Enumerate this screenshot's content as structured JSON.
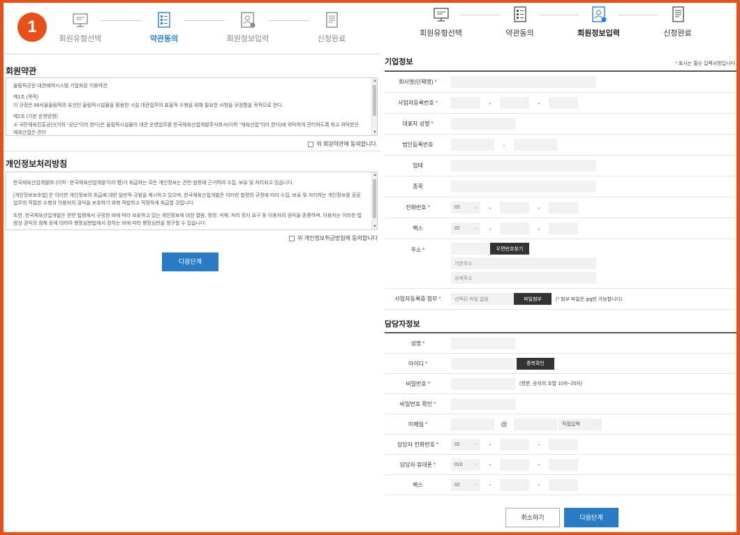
{
  "left": {
    "step_number": "1",
    "steps": [
      "회원유형선택",
      "약관동의",
      "회원정보입력",
      "신청완료"
    ],
    "active_step": 1,
    "terms": {
      "title": "회원약관",
      "lines": [
        "올림픽공원 대관예약시스템 기업회원 이용약관",
        "제1조 (목적)",
        "이 규정은 88서울올림픽의 유산인 올림픽시설물을 활용한 시설 대관업무의 효율적 수행을 위해 필요한 사항을 규정함을 목적으로 한다.",
        "제2조 (기본 운영방향)",
        "① 국민체육진흥공단(이하 \"공단\"이라 한다)은 올림픽시설물의 대관 운영업무를 한국체육산업개발주식회사(이하 \"체육산업\"이라 한다)에 위탁하여 관리하도록 하고 위탁받은 체육산업은 관리"
      ],
      "agree_label": "위 회원약관에 동의합니다."
    },
    "privacy": {
      "title": "개인정보처리방침",
      "lines": [
        "한국체육산업개발㈜ (이하 ' 한국체육산업개발'이라 함)가 취급하는 모든 개인정보는 관련 법령에 근거하여 수집, 보유 및 처리되고 있습니다.",
        "[개인정보보호법] 은 이러한 개인정보의 취급에 대한 일반적 규범을 제시하고 있으며, 한국체육산업개발은 이러한 법령의 규정에 따라 수집, 보유 및 처리하는 개인정보를 공공업무의 적절한 수행과 이용자의 권익을 보호하기 위해 적법하고 적정하게 취급할 것입니다.",
        "또한, 한국체육산업개발은 관련 법령에서 규정한 바에 따라 보유하고 있는 개인정보에 대한 열람, 정정, 삭제, 처리 정지 요구 등 이용자의 권익을 존중하며, 이용자는 이러한 법령상 권익의 침해 등에 대하여 행정심판법에서 정하는 바에 따라 행정심판을 청구할 수 있습니다."
      ],
      "agree_label": "위 개인정보취급방침에 동의합니다"
    },
    "next_button": "다음단계"
  },
  "right": {
    "steps": [
      "회원유형선택",
      "약관동의",
      "회원정보입력",
      "신청완료"
    ],
    "active_step": 2,
    "company_section_title": "기업정보",
    "required_note": "표시는 필수 입력사항입니다.",
    "company_fields": {
      "company_name": "회사명(단체명)",
      "biz_reg_no": "사업자등록번호",
      "ceo_name": "대표자 성명",
      "corp_reg_no": "법인등록번호",
      "business_type": "업태",
      "business_item": "종목",
      "phone": "전화번호",
      "fax": "팩스",
      "address": "주소",
      "attachment": "사업자등록증 첨부"
    },
    "area_code": "02",
    "zip_button": "우편번호찾기",
    "address_basic_placeholder": "기본주소",
    "address_detail_placeholder": "상세주소",
    "file_placeholder": "선택된 파일 없음",
    "file_button": "파일첨부",
    "file_hint": "(* 첨부 파일은 jpg만 가능합니다)",
    "manager_section_title": "담당자정보",
    "manager_fields": {
      "name": "성명",
      "user_id": "아이디",
      "password": "비밀번호",
      "password_confirm": "비밀번호 확인",
      "email": "이메일",
      "manager_phone": "담당자 전화번호",
      "manager_mobile": "담당자 휴대폰",
      "fax": "팩스"
    },
    "dup_check_button": "중복확인",
    "password_hint": "(영문, 숫자의 조합 10자~20자)",
    "email_at": "@",
    "email_domain_select": "직접입력",
    "mobile_prefix": "010",
    "cancel_button": "취소하기",
    "next_button": "다음단계"
  },
  "colors": {
    "frame": "#e8501a",
    "accent_blue": "#2a7bc6",
    "required_star": "#e8201a"
  },
  "icons": [
    "monitor-icon",
    "document-checklist-icon",
    "user-form-icon",
    "completed-document-icon"
  ]
}
